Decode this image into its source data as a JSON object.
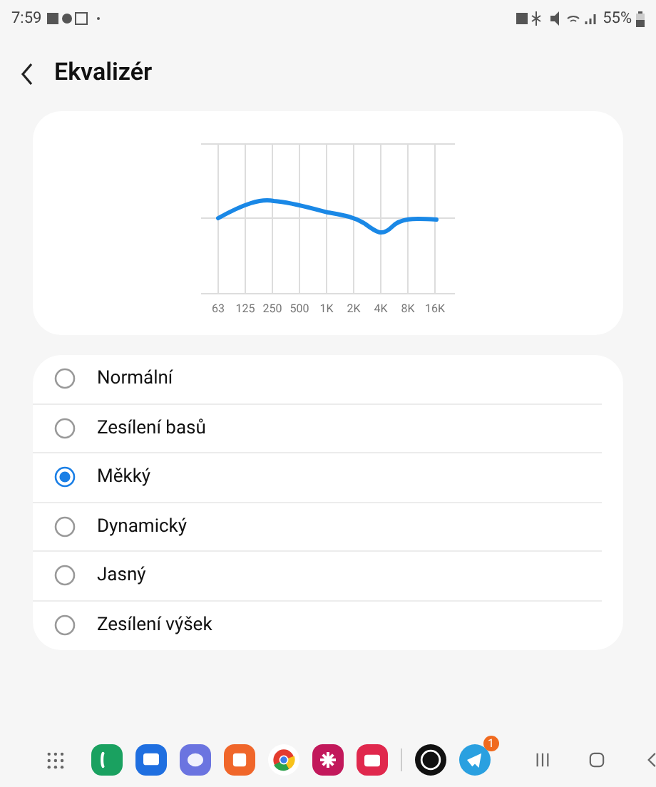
{
  "status_bar": {
    "time": "7:59",
    "battery": "55%"
  },
  "header": {
    "title": "Ekvalizér"
  },
  "equalizer": {
    "bands": [
      "63",
      "125",
      "250",
      "500",
      "1K",
      "2K",
      "4K",
      "8K",
      "16K"
    ]
  },
  "presets": [
    {
      "label": "Normální",
      "selected": false
    },
    {
      "label": "Zesílení basů",
      "selected": false
    },
    {
      "label": "Měkký",
      "selected": true
    },
    {
      "label": "Dynamický",
      "selected": false
    },
    {
      "label": "Jasný",
      "selected": false
    },
    {
      "label": "Zesílení výšek",
      "selected": false
    }
  ],
  "taskbar": {
    "apps": [
      {
        "color": "#1aa160"
      },
      {
        "color": "#1f6fe0"
      },
      {
        "color": "#6b74e0"
      },
      {
        "color": "#f0662a"
      },
      {
        "color": "#ffffff"
      },
      {
        "color": "#c2185b"
      },
      {
        "color": "#e0284d"
      },
      {
        "color": "#111111"
      },
      {
        "color": "#2aa0e0",
        "badge": "1"
      }
    ]
  }
}
